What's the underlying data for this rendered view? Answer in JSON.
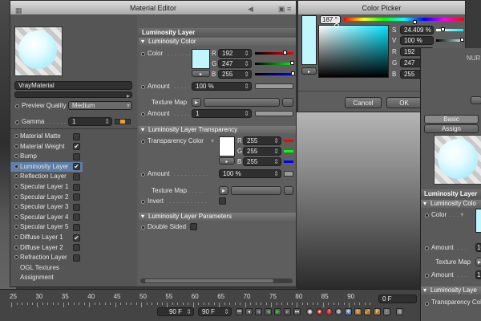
{
  "material_editor": {
    "title": "Material Editor",
    "material_name": "VrayMaterial",
    "preview_quality_label": "Preview Quality",
    "preview_quality_value": "Medium",
    "gamma_label": "Gamma",
    "gamma_value": "1",
    "channels": [
      {
        "label": "Material Matte",
        "checked": false
      },
      {
        "label": "Material Weight",
        "checked": true
      },
      {
        "label": "Bump",
        "checked": false
      },
      {
        "label": "Luminosity Layer",
        "checked": true,
        "selected": true
      },
      {
        "label": "Reflection Layer",
        "checked": false
      },
      {
        "label": "Specular Layer 1",
        "checked": false
      },
      {
        "label": "Specular Layer 2",
        "checked": false
      },
      {
        "label": "Specular Layer 3",
        "checked": false
      },
      {
        "label": "Specular Layer 4",
        "checked": false
      },
      {
        "label": "Specular Layer 5",
        "checked": false
      },
      {
        "label": "Diffuse Layer 1",
        "checked": true
      },
      {
        "label": "Diffuse Layer 2",
        "checked": false
      },
      {
        "label": "Refraction Layer",
        "checked": false
      },
      {
        "label": "OGL Textures",
        "checked": null
      },
      {
        "label": "Assignment",
        "checked": null
      }
    ],
    "panel_title": "Luminosity Layer",
    "sections": {
      "color": {
        "title": "Luminosity Color",
        "color_label": "Color",
        "r": "192",
        "g": "247",
        "b": "255",
        "amount_label": "Amount",
        "amount_value": "100 %",
        "texture_map_label": "Texture Map",
        "amount2_label": "Amount",
        "amount2_value": "1"
      },
      "transparency": {
        "title": "Luminosity Layer Transparency",
        "color_label": "Transparency Color",
        "r": "255",
        "g": "255",
        "b": "255",
        "amount_label": "Amount",
        "amount_value": "100 %",
        "texture_map_label": "Texture Map",
        "invert_label": "Invert"
      },
      "parameters": {
        "title": "Luminosity Layer Parameters",
        "double_sided_label": "Double Sided"
      }
    },
    "colors": {
      "swatch": "#c0f7ff",
      "transparency_swatch": "#ffffff"
    }
  },
  "color_picker": {
    "title": "Color Picker",
    "hue_value": "187 °",
    "s_label": "S",
    "s_value": "24.409 %",
    "v_label": "V",
    "v_value": "100 %",
    "r_label": "R",
    "r_value": "192",
    "g_label": "G",
    "g_value": "247",
    "b_label": "B",
    "b_value": "255",
    "cancel_label": "Cancel",
    "ok_label": "OK",
    "hue_color": "#00e5ff"
  },
  "right_panel": {
    "tab_basic": "Basic",
    "tab_assign": "Assign",
    "nurbs_hint": "NURB",
    "panel_title": "Luminosity Layer",
    "section_title": "Luminosity Colo",
    "color_label": "Color",
    "amount_label": "Amount",
    "amount_value": "10",
    "texture_map_label": "Texture Map",
    "amount2_label": "Amount",
    "amount2_value": "1",
    "transparency_head": "Luminosity Laye",
    "transparency_label": "Transparency Col"
  },
  "timeline": {
    "ticks": [
      "25",
      "30",
      "35",
      "40",
      "45",
      "50",
      "55",
      "60",
      "65",
      "70",
      "75",
      "80",
      "85",
      "90"
    ],
    "frame_field": "0 F",
    "start_field": "90 F",
    "end_field": "90 F"
  }
}
